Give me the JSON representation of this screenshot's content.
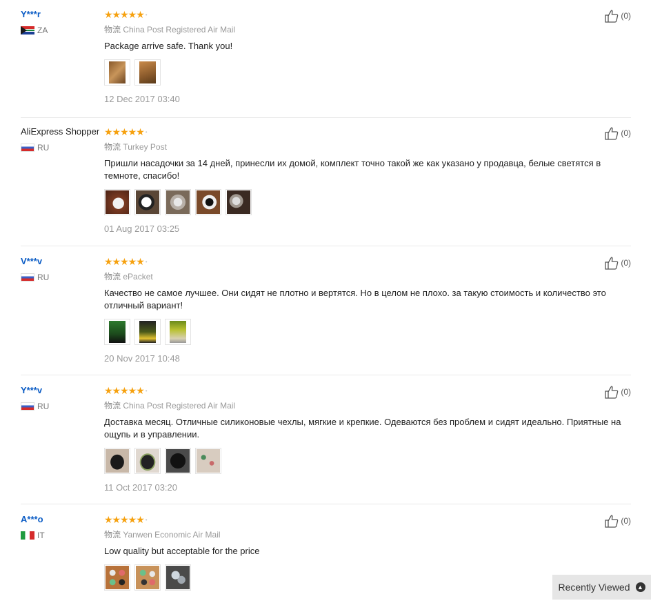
{
  "reviews": [
    {
      "user": "Y***r",
      "country": "ZA",
      "logistics_cn": "物流",
      "logistics": "China Post Registered Air Mail",
      "feedback": "Package arrive safe. Thank you!",
      "date": "12 Dec 2017 03:40",
      "useful": "(0)"
    },
    {
      "user": "AliExpress Shopper",
      "country": "RU",
      "logistics_cn": "物流",
      "logistics": "Turkey Post",
      "feedback": "Пришли насадочки за 14 дней, принесли их домой, комплект точно такой же как указано у продавца, белые светятся в темноте, спасибо!",
      "date": "01 Aug 2017 03:25",
      "useful": "(0)"
    },
    {
      "user": "V***v",
      "country": "RU",
      "logistics_cn": "物流",
      "logistics": "ePacket",
      "feedback": "Качество не самое лучшее. Они сидят не плотно и вертятся. Но в целом не плохо. за такую стоимость и количество это отличный вариант!",
      "date": "20 Nov 2017 10:48",
      "useful": "(0)"
    },
    {
      "user": "Y***v",
      "country": "RU",
      "logistics_cn": "物流",
      "logistics": "China Post Registered Air Mail",
      "feedback": "Доставка месяц. Отличные силиконовые чехлы, мягкие и крепкие. Одеваются без проблем и сидят идеально. Приятные на ощупь и в управлении.",
      "date": "11 Oct 2017 03:20",
      "useful": "(0)"
    },
    {
      "user": "A***o",
      "country": "IT",
      "logistics_cn": "物流",
      "logistics": "Yanwen Economic Air Mail",
      "feedback": "Low quality but acceptable for the price",
      "date": "",
      "useful": "(0)"
    }
  ],
  "recently_viewed": {
    "label": "Recently Viewed"
  },
  "colors": {
    "star": "#f6a10f",
    "masked_user": "#0b5cc5",
    "meta": "#999999"
  }
}
